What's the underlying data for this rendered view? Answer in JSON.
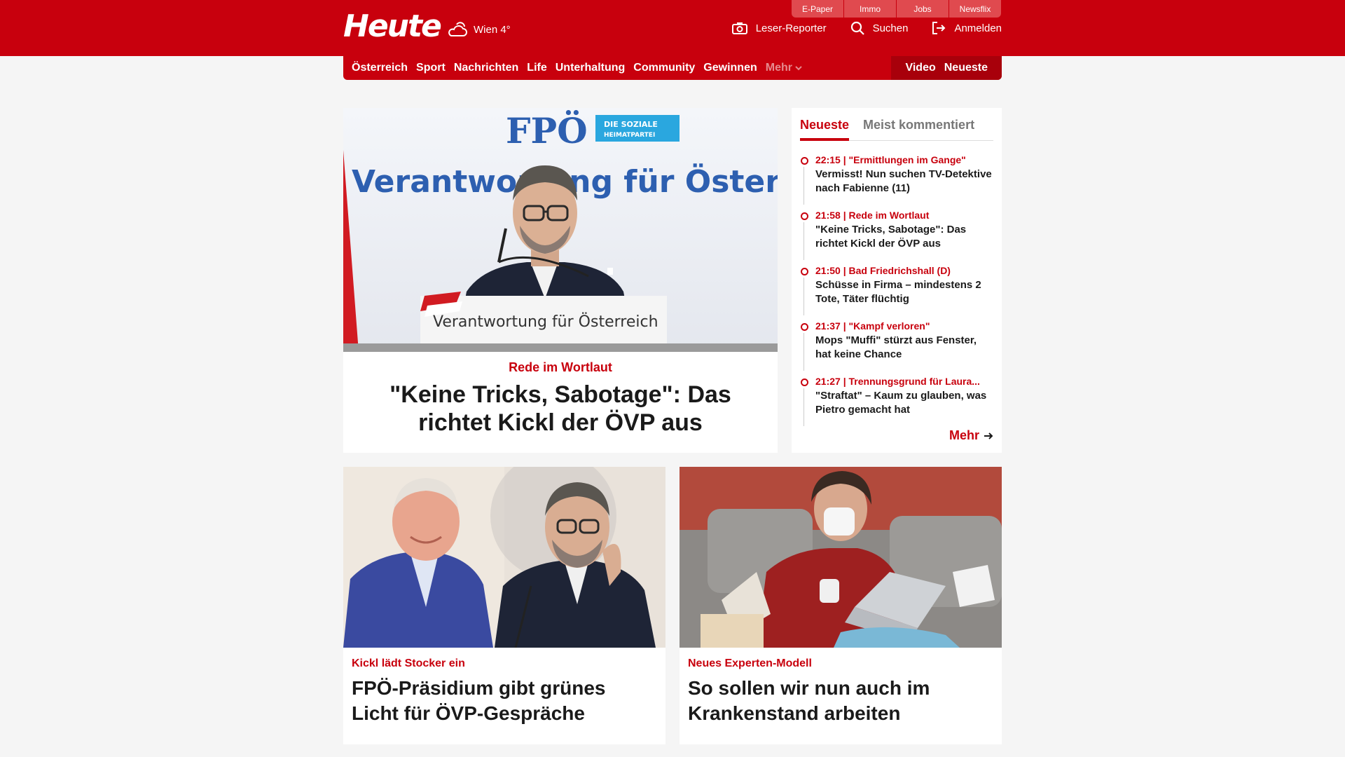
{
  "brand": {
    "logo_text": "Heute",
    "primary_color": "#c8000d"
  },
  "weather": {
    "icon": "cloud-sun-icon",
    "text": "Wien 4°"
  },
  "utility_tabs": [
    "E-Paper",
    "Immo",
    "Jobs",
    "Newsflix"
  ],
  "header_actions": [
    {
      "label": "Leser-Reporter",
      "icon": "camera-icon"
    },
    {
      "label": "Suchen",
      "icon": "search-icon"
    },
    {
      "label": "Anmelden",
      "icon": "login-icon"
    }
  ],
  "nav": {
    "items": [
      "Österreich",
      "Sport",
      "Nachrichten",
      "Life",
      "Unterhaltung",
      "Community",
      "Gewinnen"
    ],
    "more": "Mehr",
    "right": [
      "Video",
      "Neueste"
    ]
  },
  "hero": {
    "kicker": "Rede im Wortlaut",
    "title": "\"Keine Tricks, Sabotage\": Das richtet Kickl der ÖVP aus",
    "image_text": {
      "party": "FPÖ",
      "badge_line1": "DIE SOZIALE",
      "badge_line2": "HEIMATPARTEI",
      "backdrop": "Verantwortung für Österreich",
      "podium": "Verantwortung für Österreich"
    }
  },
  "sidebar": {
    "tabs": [
      "Neueste",
      "Meist kommentiert"
    ],
    "items": [
      {
        "meta": "22:15 | \"Ermittlungen im Gange\"",
        "title": "Vermisst! Nun suchen TV-Detektive nach Fabienne (11)"
      },
      {
        "meta": "21:58 | Rede im Wortlaut",
        "title": "\"Keine Tricks, Sabotage\": Das richtet Kickl der ÖVP aus"
      },
      {
        "meta": "21:50 | Bad Friedrichshall (D)",
        "title": "Schüsse in Firma – mindestens 2 Tote, Täter flüchtig"
      },
      {
        "meta": "21:37 | \"Kampf verloren\"",
        "title": "Mops \"Muffi\" stürzt aus Fenster, hat keine Chance"
      },
      {
        "meta": "21:27 | Trennungsgrund für Laura...",
        "title": "\"Straftat\" – Kaum zu glauben, was Pietro gemacht hat"
      }
    ],
    "more": "Mehr"
  },
  "cards": [
    {
      "kicker": "Kickl lädt Stocker ein",
      "title": "FPÖ-Präsidium gibt grünes Licht für ÖVP-Gespräche"
    },
    {
      "kicker": "Neues Experten-Modell",
      "title": "So sollen wir nun auch im Krankenstand arbeiten"
    }
  ]
}
